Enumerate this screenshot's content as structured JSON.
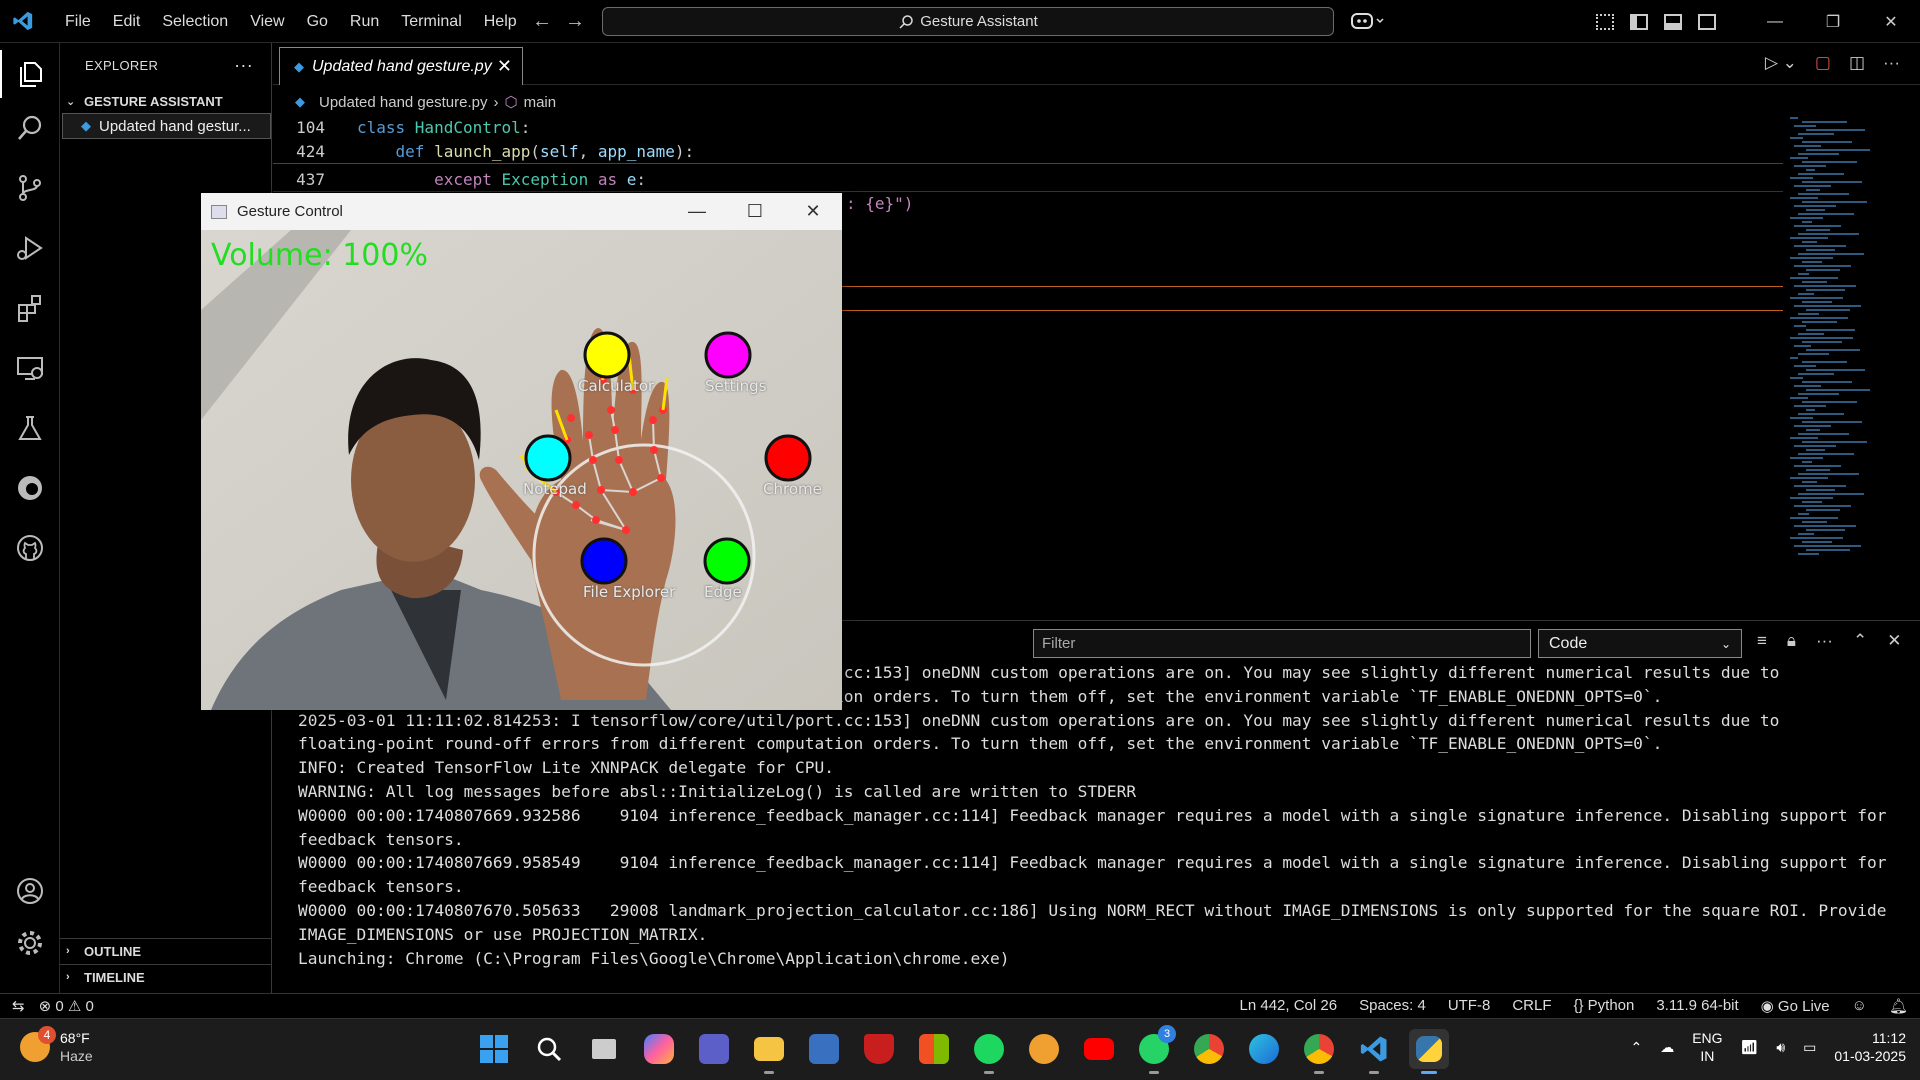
{
  "app": {
    "menus": [
      "File",
      "Edit",
      "Selection",
      "View",
      "Go",
      "Run",
      "Terminal",
      "Help"
    ],
    "command_center": "Gesture Assistant",
    "copilot_icon": "copilot-icon"
  },
  "sidebar": {
    "title": "EXPLORER",
    "folder": "GESTURE ASSISTANT",
    "file": "Updated hand gestur...",
    "outline": "OUTLINE",
    "timeline": "TIMELINE"
  },
  "editor": {
    "tab_label": "Updated hand gesture.py",
    "breadcrumb_file": "Updated hand gesture.py",
    "breadcrumb_symbol": "main",
    "lines": [
      {
        "num": "104",
        "indent": "",
        "tokens": [
          [
            "kw",
            "class "
          ],
          [
            "cls",
            "HandControl"
          ],
          [
            "",
            ":"
          ]
        ]
      },
      {
        "num": "424",
        "indent": "    ",
        "tokens": [
          [
            "kw",
            "def "
          ],
          [
            "fn",
            "launch_app"
          ],
          [
            "",
            "("
          ],
          [
            "par",
            "self"
          ],
          [
            "",
            ", "
          ],
          [
            "par",
            "app_name"
          ],
          [
            "",
            "):"
          ]
        ]
      },
      {
        "num": "437",
        "indent": "        ",
        "tokens": [
          [
            "ctl",
            "except "
          ],
          [
            "cls",
            "Exception"
          ],
          [
            "ctl",
            " as "
          ],
          [
            "par",
            "e"
          ],
          [
            "",
            ":"
          ]
        ]
      }
    ],
    "hidden_fragment": ": {e}\")"
  },
  "panel": {
    "filter_placeholder": "Filter",
    "output_channel": "Code",
    "log": "2025-03-01 11:11:02.814253: I tensorflow/core/util/port.cc:153] oneDNN custom operations are on. You may see slightly different numerical results due to\nfloating-point round-off errors from different computation orders. To turn them off, set the environment variable `TF_ENABLE_ONEDNN_OPTS=0`.\n2025-03-01 11:11:02.814253: I tensorflow/core/util/port.cc:153] oneDNN custom operations are on. You may see slightly different numerical results due to\nfloating-point round-off errors from different computation orders. To turn them off, set the environment variable `TF_ENABLE_ONEDNN_OPTS=0`.\nINFO: Created TensorFlow Lite XNNPACK delegate for CPU.\nWARNING: All log messages before absl::InitializeLog() is called are written to STDERR\nW0000 00:00:1740807669.932586    9104 inference_feedback_manager.cc:114] Feedback manager requires a model with a single signature inference. Disabling support for\nfeedback tensors.\nW0000 00:00:1740807669.958549    9104 inference_feedback_manager.cc:114] Feedback manager requires a model with a single signature inference. Disabling support for\nfeedback tensors.\nW0000 00:00:1740807670.505633   29008 landmark_projection_calculator.cc:186] Using NORM_RECT without IMAGE_DIMENSIONS is only supported for the square ROI. Provide\nIMAGE_DIMENSIONS or use PROJECTION_MATRIX.\nLaunching: Chrome (C:\\Program Files\\Google\\Chrome\\Application\\chrome.exe)"
  },
  "statusbar": {
    "errors": "0",
    "warnings": "0",
    "position": "Ln 442, Col 26",
    "spaces": "Spaces: 4",
    "encoding": "UTF-8",
    "eol": "CRLF",
    "language": "Python",
    "interpreter": "3.11.9 64-bit",
    "golive": "Go Live"
  },
  "gesture_window": {
    "title": "Gesture Control",
    "volume_text": "Volume: 100%",
    "buttons": [
      {
        "label": "Calculator",
        "color": "#ffff00"
      },
      {
        "label": "Settings",
        "color": "#ff00ff"
      },
      {
        "label": "Notepad",
        "color": "#00ffff"
      },
      {
        "label": "Chrome",
        "color": "#ff0000"
      },
      {
        "label": "File Explorer",
        "color": "#0000ff"
      },
      {
        "label": "Edge",
        "color": "#00ff00"
      }
    ]
  },
  "taskbar": {
    "weather_temp": "68°F",
    "weather_cond": "Haze",
    "weather_badge": "4",
    "whatsapp_badge": "3",
    "lang_line1": "ENG",
    "lang_line2": "IN",
    "time": "11:12",
    "date": "01-03-2025"
  },
  "colors": {
    "accent": "#3c9be0",
    "keyword": "#569cd6",
    "class": "#4ec9b0",
    "function": "#dcdcaa",
    "param": "#9cdcfe",
    "control": "#c586c0",
    "volume_text": "#22dd22"
  }
}
